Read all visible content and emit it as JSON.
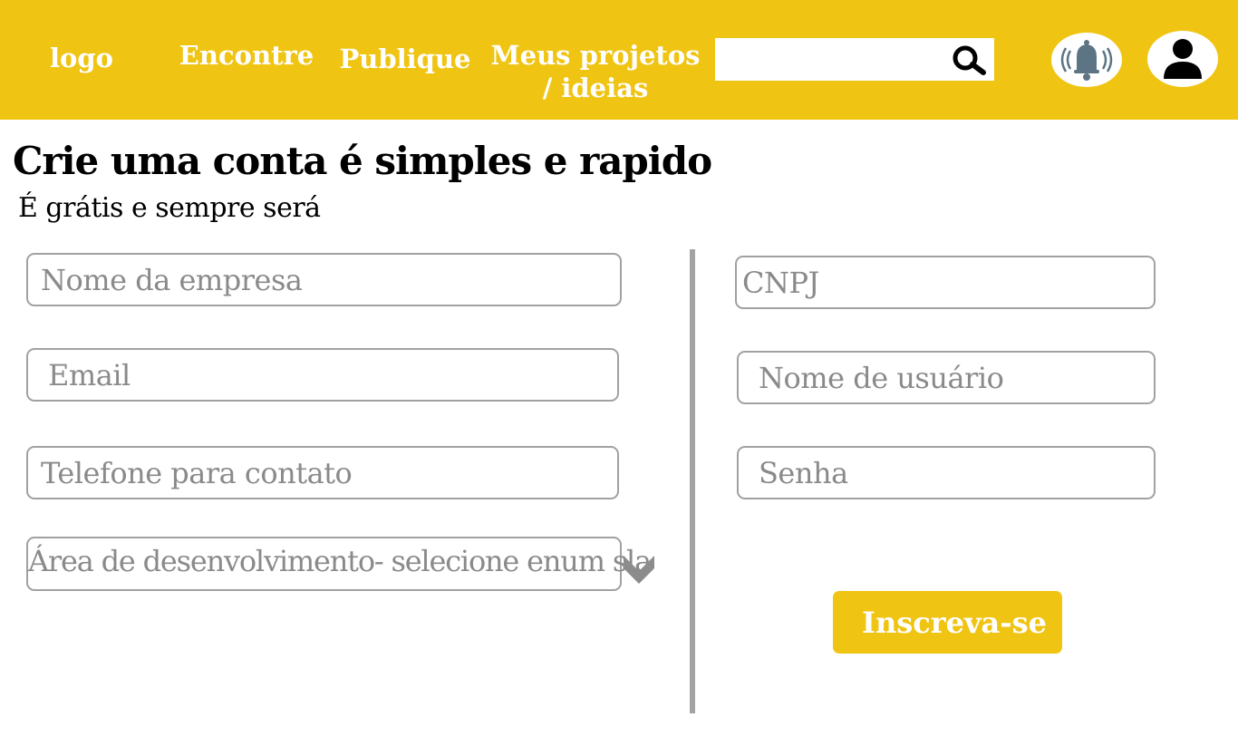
{
  "header": {
    "logo_text": "logo",
    "nav": {
      "encontre": "Encontre",
      "publique": "Publique",
      "meus_line1": "Meus projetos",
      "meus_line2": "/ ideias"
    },
    "search": {
      "value": "",
      "placeholder": "",
      "icon": "search-icon"
    },
    "notifications_icon": "bell-icon",
    "profile_icon": "user-icon",
    "colors": {
      "bar": "#f0c413",
      "nav_text": "#ffffff",
      "bell": "#5c7484"
    }
  },
  "main": {
    "title": "Crie uma conta é simples e rapido",
    "subtitle": "É grátis e sempre será",
    "form": {
      "left": {
        "company_name": "Nome da empresa",
        "email": "Email",
        "phone": "Telefone para contato",
        "area_select": "Área de desenvolvimento- selecione enum sla"
      },
      "right": {
        "cnpj": "CNPJ",
        "username": "Nome de usuário",
        "password": "Senha"
      },
      "submit_label": "Inscreva-se"
    },
    "colors": {
      "field_border": "#a1a1a1",
      "placeholder": "#8a8a8a",
      "divider": "#a3a3a3",
      "button": "#f0c413"
    }
  }
}
